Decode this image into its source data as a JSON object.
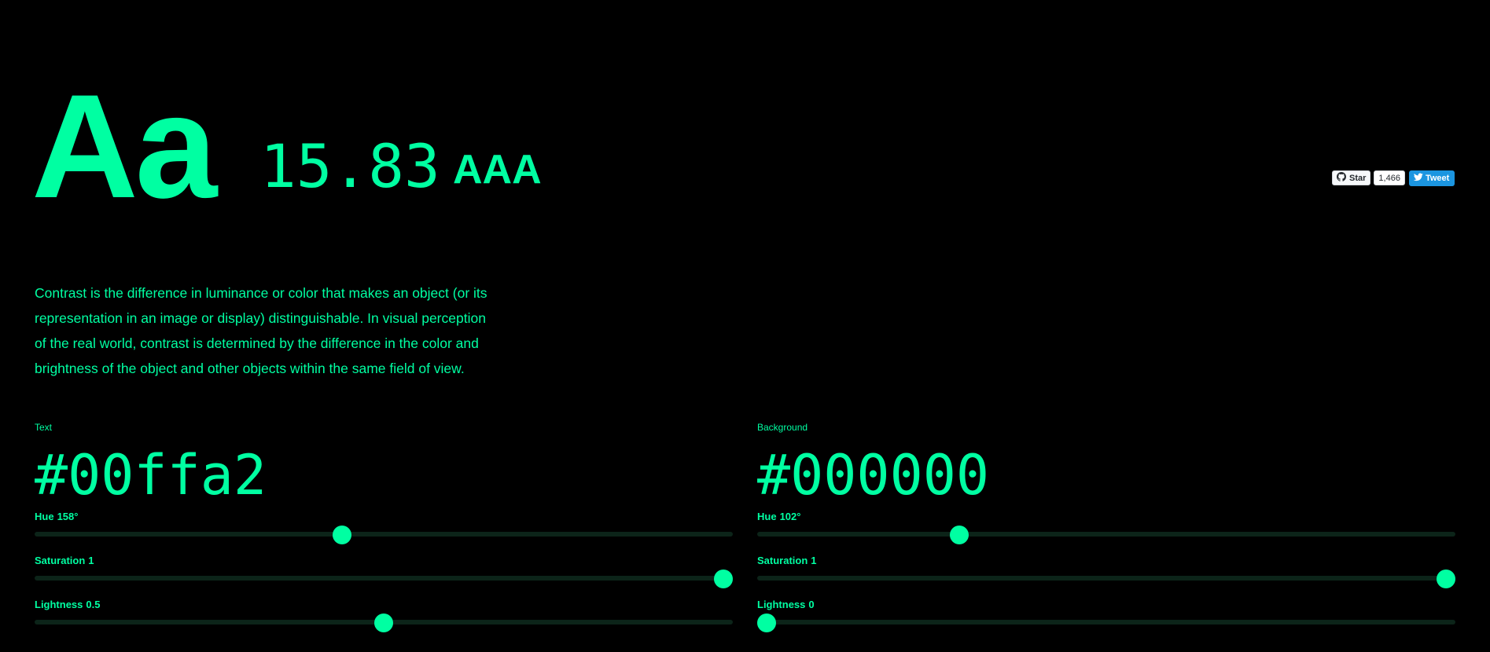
{
  "hero": {
    "sample": "Aa",
    "ratio": "15.83",
    "grade": "AAA"
  },
  "social": {
    "github_label": "Star",
    "github_count": "1,466",
    "tweet_label": "Tweet"
  },
  "intro": "Contrast is the difference in luminance or color that makes an object (or its representation in an image or display) distinguishable. In visual perception of the real world, contrast is determined by the difference in the color and brightness of the object and other objects within the same field of view.",
  "text_color": {
    "label": "Text",
    "hex": "#00ffa2",
    "hue": {
      "label": "Hue",
      "display": "158°",
      "value": 158,
      "min": 0,
      "max": 360
    },
    "saturation": {
      "label": "Saturation",
      "display": "1",
      "value": 1,
      "min": 0,
      "max": 1
    },
    "lightness": {
      "label": "Lightness",
      "display": "0.5",
      "value": 0.5,
      "min": 0,
      "max": 1
    }
  },
  "background_color": {
    "label": "Background",
    "hex": "#000000",
    "hue": {
      "label": "Hue",
      "display": "102°",
      "value": 102,
      "min": 0,
      "max": 360
    },
    "saturation": {
      "label": "Saturation",
      "display": "1",
      "value": 1,
      "min": 0,
      "max": 1
    },
    "lightness": {
      "label": "Lightness",
      "display": "0",
      "value": 0,
      "min": 0,
      "max": 1
    }
  },
  "colors": {
    "foreground": "#00ffa2",
    "background": "#000000",
    "track": "#0c2419",
    "tweet": "#1b95e0"
  },
  "icons": {
    "github": "github-icon",
    "twitter": "twitter-bird-icon"
  }
}
